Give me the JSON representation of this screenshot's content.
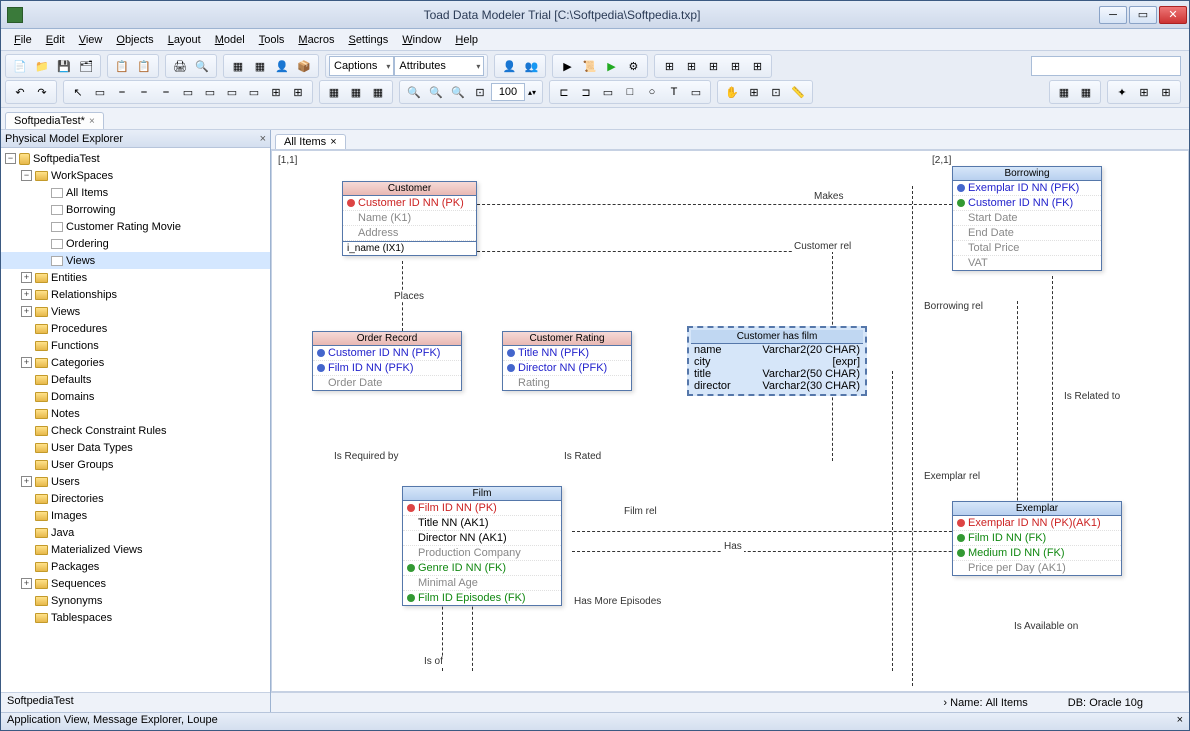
{
  "title": "Toad Data Modeler Trial [C:\\Softpedia\\Softpedia.txp]",
  "menu": [
    "File",
    "Edit",
    "View",
    "Objects",
    "Layout",
    "Model",
    "Tools",
    "Macros",
    "Settings",
    "Window",
    "Help"
  ],
  "dropdowns": {
    "captions": "Captions",
    "attributes": "Attributes",
    "zoom": "100"
  },
  "fileTab": "SoftpediaTest*",
  "explorer": {
    "title": "Physical Model Explorer",
    "root": "SoftpediaTest",
    "workspaces_label": "WorkSpaces",
    "workspaces": [
      "All Items",
      "Borrowing",
      "Customer Rating Movie",
      "Ordering",
      "Views"
    ],
    "folders": [
      "Entities",
      "Relationships",
      "Views",
      "Procedures",
      "Functions",
      "Categories",
      "Defaults",
      "Domains",
      "Notes",
      "Check Constraint Rules",
      "User Data Types",
      "User Groups",
      "Users",
      "Directories",
      "Images",
      "Java",
      "Materialized Views",
      "Packages",
      "Sequences",
      "Synonyms",
      "Tablespaces"
    ],
    "footer": "SoftpediaTest"
  },
  "canvas": {
    "tab": "All Items",
    "coord1": "[1,1]",
    "coord2": "[2,1]",
    "entities": {
      "customer": {
        "title": "Customer",
        "rows": [
          {
            "k": "pk",
            "t": "Customer ID NN  (PK)",
            "c": "main"
          },
          {
            "k": "",
            "t": "Name  (K1)",
            "c": "grey"
          },
          {
            "k": "",
            "t": "Address",
            "c": "grey"
          }
        ],
        "idx": "i_name (IX1)"
      },
      "borrowing": {
        "title": "Borrowing",
        "rows": [
          {
            "k": "bk",
            "t": "Exemplar ID NN  (PFK)",
            "c": "fk"
          },
          {
            "k": "fk",
            "t": "Customer ID NN  (FK)",
            "c": "fk"
          },
          {
            "k": "",
            "t": "Start Date",
            "c": "grey"
          },
          {
            "k": "",
            "t": "End Date",
            "c": "grey"
          },
          {
            "k": "",
            "t": "Total Price",
            "c": "grey"
          },
          {
            "k": "",
            "t": "VAT",
            "c": "grey"
          }
        ]
      },
      "orderRecord": {
        "title": "Order Record",
        "rows": [
          {
            "k": "bk",
            "t": "Customer ID NN  (PFK)",
            "c": "fk"
          },
          {
            "k": "bk",
            "t": "Film ID NN  (PFK)",
            "c": "fk"
          },
          {
            "k": "",
            "t": "Order Date",
            "c": "grey"
          }
        ]
      },
      "customerRating": {
        "title": "Customer Rating",
        "rows": [
          {
            "k": "bk",
            "t": "Title NN  (PFK)",
            "c": "fk"
          },
          {
            "k": "bk",
            "t": "Director NN  (PFK)",
            "c": "fk"
          },
          {
            "k": "",
            "t": "Rating",
            "c": "grey"
          }
        ]
      },
      "film": {
        "title": "Film",
        "rows": [
          {
            "k": "pk",
            "t": "Film ID NN  (PK)",
            "c": "main"
          },
          {
            "k": "",
            "t": "Title NN  (AK1)",
            "c": ""
          },
          {
            "k": "",
            "t": "Director NN  (AK1)",
            "c": ""
          },
          {
            "k": "",
            "t": "Production Company",
            "c": "grey"
          },
          {
            "k": "fk",
            "t": "Genre ID NN  (FK)",
            "c": "green"
          },
          {
            "k": "",
            "t": "Minimal Age",
            "c": "grey"
          },
          {
            "k": "fk",
            "t": "Film ID Episodes   (FK)",
            "c": "green"
          }
        ]
      },
      "exemplar": {
        "title": "Exemplar",
        "rows": [
          {
            "k": "pk",
            "t": "Exemplar ID NN  (PK)(AK1)",
            "c": "main"
          },
          {
            "k": "fk",
            "t": "Film ID NN  (FK)",
            "c": "green"
          },
          {
            "k": "fk",
            "t": "Medium ID NN  (FK)",
            "c": "green"
          },
          {
            "k": "",
            "t": "Price per Day  (AK1)",
            "c": "grey"
          }
        ]
      }
    },
    "view": {
      "title": "Customer has film",
      "rows": [
        [
          "name",
          "Varchar2(20 CHAR)"
        ],
        [
          "city",
          "[expr]"
        ],
        [
          "title",
          "Varchar2(50 CHAR)"
        ],
        [
          "director",
          "Varchar2(30 CHAR)"
        ]
      ]
    },
    "labels": {
      "makes": "Makes",
      "customerRel": "Customer rel",
      "places": "Places",
      "isRequiredBy": "Is Required by",
      "isRated": "Is Rated",
      "filmRel": "Film rel",
      "has": "Has",
      "hasMoreEpisodes": "Has More Episodes",
      "isOf": "Is of",
      "borrowingRel": "Borrowing rel",
      "isRelatedTo": "Is Related to",
      "exemplarRel": "Exemplar rel",
      "isAvailableOn": "Is Available on"
    }
  },
  "status": {
    "name_label": "Name:",
    "name": "All Items",
    "db_label": "DB:",
    "db": "Oracle 10g"
  },
  "appview": "Application View, Message Explorer, Loupe"
}
